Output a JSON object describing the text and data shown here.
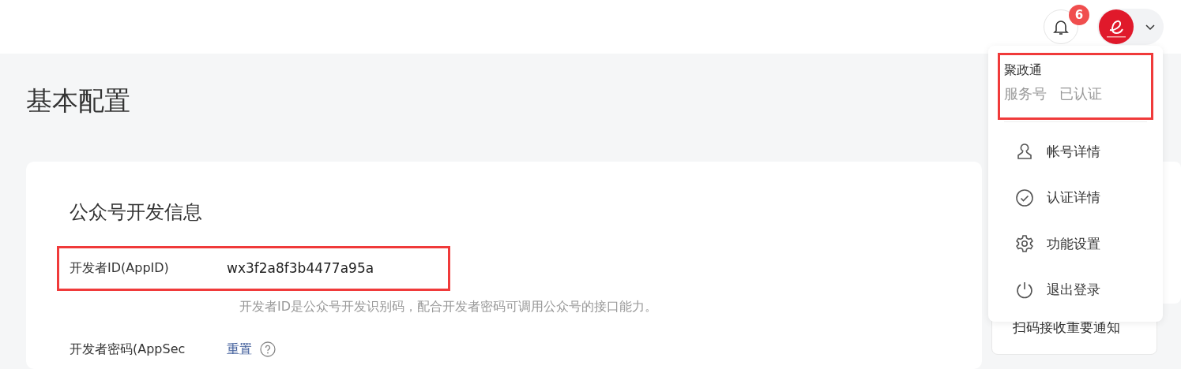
{
  "header": {
    "notification_count": "6",
    "menu_expanded": true
  },
  "page_title": "基本配置",
  "section": {
    "title": "公众号开发信息",
    "fields": [
      {
        "kind": "value",
        "label": "开发者ID(AppID)",
        "value": "wx3f2a8f3b4477a95a",
        "description": "开发者ID是公众号开发识别码，配合开发者密码可调用公众号的接口能力。",
        "highlighted": true
      },
      {
        "kind": "link",
        "label": "开发者密码(AppSec",
        "link": "重置"
      }
    ]
  },
  "side_panel": {
    "notice": "扫码接收重要通知"
  },
  "account_menu": {
    "name": "聚政通",
    "type": "服务号",
    "status": "已认证",
    "highlighted": true,
    "items": [
      {
        "kind": "user",
        "label": "帐号详情"
      },
      {
        "kind": "check",
        "label": "认证详情"
      },
      {
        "kind": "gear",
        "label": "功能设置"
      },
      {
        "kind": "power",
        "label": "退出登录"
      }
    ]
  }
}
